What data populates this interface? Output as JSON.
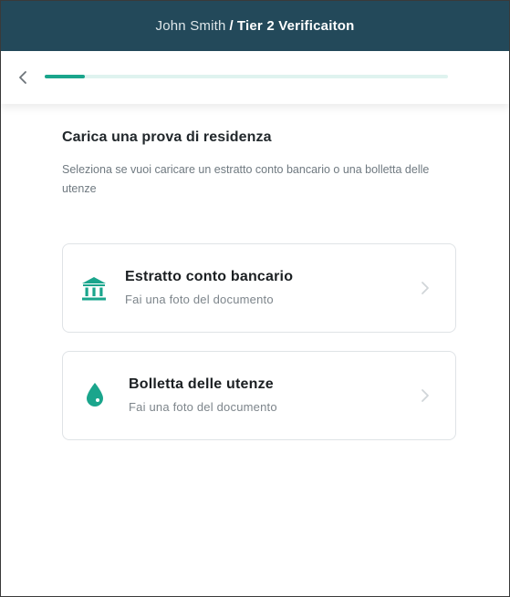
{
  "header": {
    "user_name": "John Smith",
    "separator": "/",
    "tier_label": "Tier 2 Verificaiton"
  },
  "progress": {
    "fraction": 0.1
  },
  "page": {
    "title": "Carica una prova di residenza",
    "subtitle": "Seleziona se vuoi caricare un estratto conto bancario o una bolletta delle utenze"
  },
  "options": [
    {
      "title": "Estratto conto bancario",
      "subtitle": "Fai una foto del documento",
      "icon": "bank-icon"
    },
    {
      "title": "Bolletta delle utenze",
      "subtitle": "Fai una foto del documento",
      "icon": "water-drop-icon"
    }
  ],
  "colors": {
    "header_bg": "#23495a",
    "accent": "#1aa58c",
    "progress_track": "#dff3ef"
  }
}
